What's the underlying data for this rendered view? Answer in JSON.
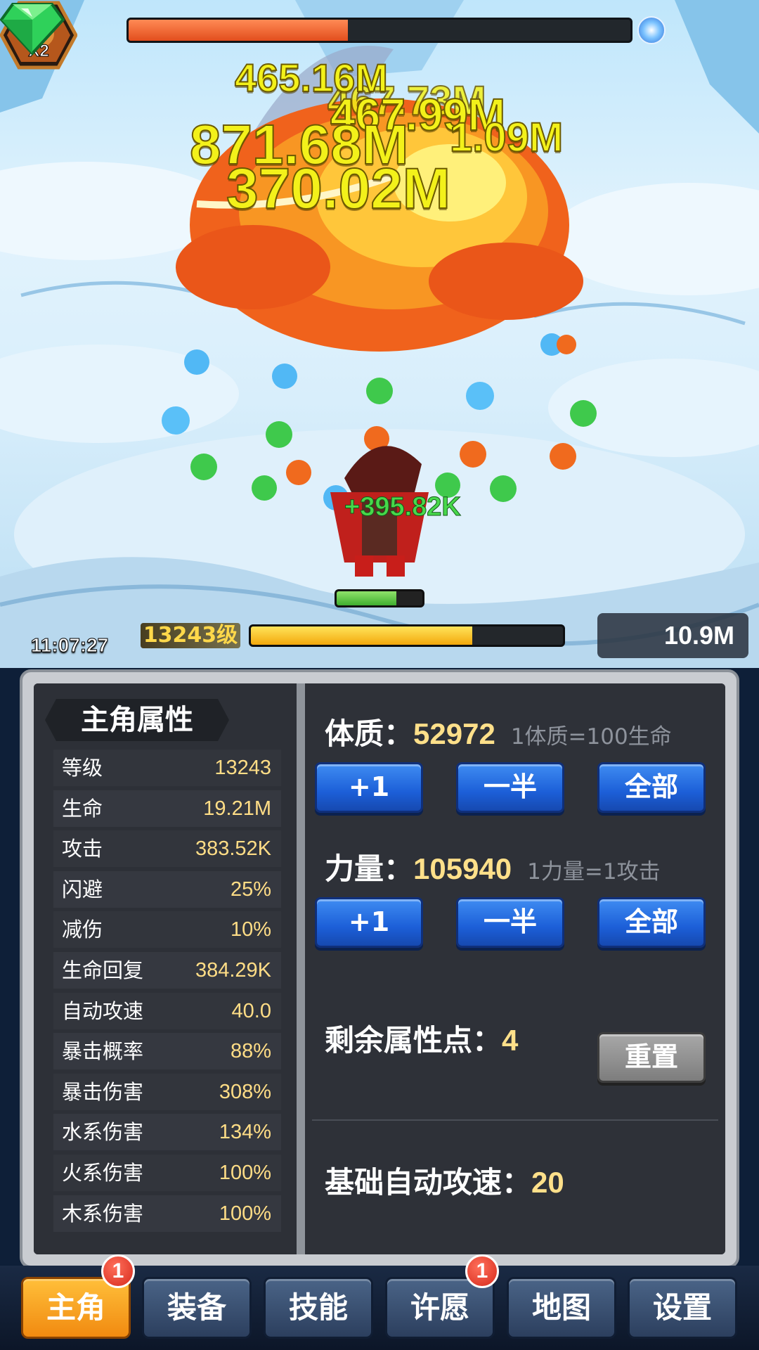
{
  "boss": {
    "hp_fraction": 0.4375
  },
  "damage_numbers": [
    "465.16M",
    "467.73M",
    "467.99M",
    "871.68M",
    "1.09M",
    "370.02M"
  ],
  "heal_number": "+395.82K",
  "hero": {
    "hp_fraction": 0.7
  },
  "buff": {
    "label": "X2",
    "timer": "11:07:27"
  },
  "player": {
    "level_label": "13243级",
    "exp_fraction": 0.71
  },
  "currency": {
    "gems": "10.9M"
  },
  "attributes_panel": {
    "title": "主角属性",
    "stats": [
      {
        "name": "等级",
        "value": "13243"
      },
      {
        "name": "生命",
        "value": "19.21M"
      },
      {
        "name": "攻击",
        "value": "383.52K"
      },
      {
        "name": "闪避",
        "value": "25%"
      },
      {
        "name": "减伤",
        "value": "10%"
      },
      {
        "name": "生命回复",
        "value": "384.29K"
      },
      {
        "name": "自动攻速",
        "value": "40.0"
      },
      {
        "name": "暴击概率",
        "value": "88%"
      },
      {
        "name": "暴击伤害",
        "value": "308%"
      },
      {
        "name": "水系伤害",
        "value": "134%"
      },
      {
        "name": "火系伤害",
        "value": "100%"
      },
      {
        "name": "木系伤害",
        "value": "100%"
      }
    ]
  },
  "allocation": {
    "constitution": {
      "label": "体质：",
      "value": "52972",
      "hint": "1体质=100生命"
    },
    "strength": {
      "label": "力量：",
      "value": "105940",
      "hint": "1力量=1攻击"
    },
    "buttons": {
      "plus_one": "+1",
      "half": "一半",
      "all": "全部"
    },
    "remaining": {
      "label": "剩余属性点：",
      "value": "4"
    },
    "reset": "重置",
    "base_attack_speed": {
      "label": "基础自动攻速：",
      "value": "20"
    }
  },
  "tabs": [
    {
      "label": "主角",
      "badge": "1"
    },
    {
      "label": "装备"
    },
    {
      "label": "技能"
    },
    {
      "label": "许愿",
      "badge": "1"
    },
    {
      "label": "地图"
    },
    {
      "label": "设置"
    }
  ],
  "colors": {
    "accent": "#f18a10",
    "button_blue": "#1c5fd8",
    "stat_value": "#ffdd86",
    "damage_text": "#f3f11a",
    "heal_text": "#47d84b",
    "gem": "#2fd15a"
  },
  "icons": {
    "buff": "loot-bag-icon",
    "currency": "diamond-icon",
    "boss_element": "ice-element-icon"
  }
}
